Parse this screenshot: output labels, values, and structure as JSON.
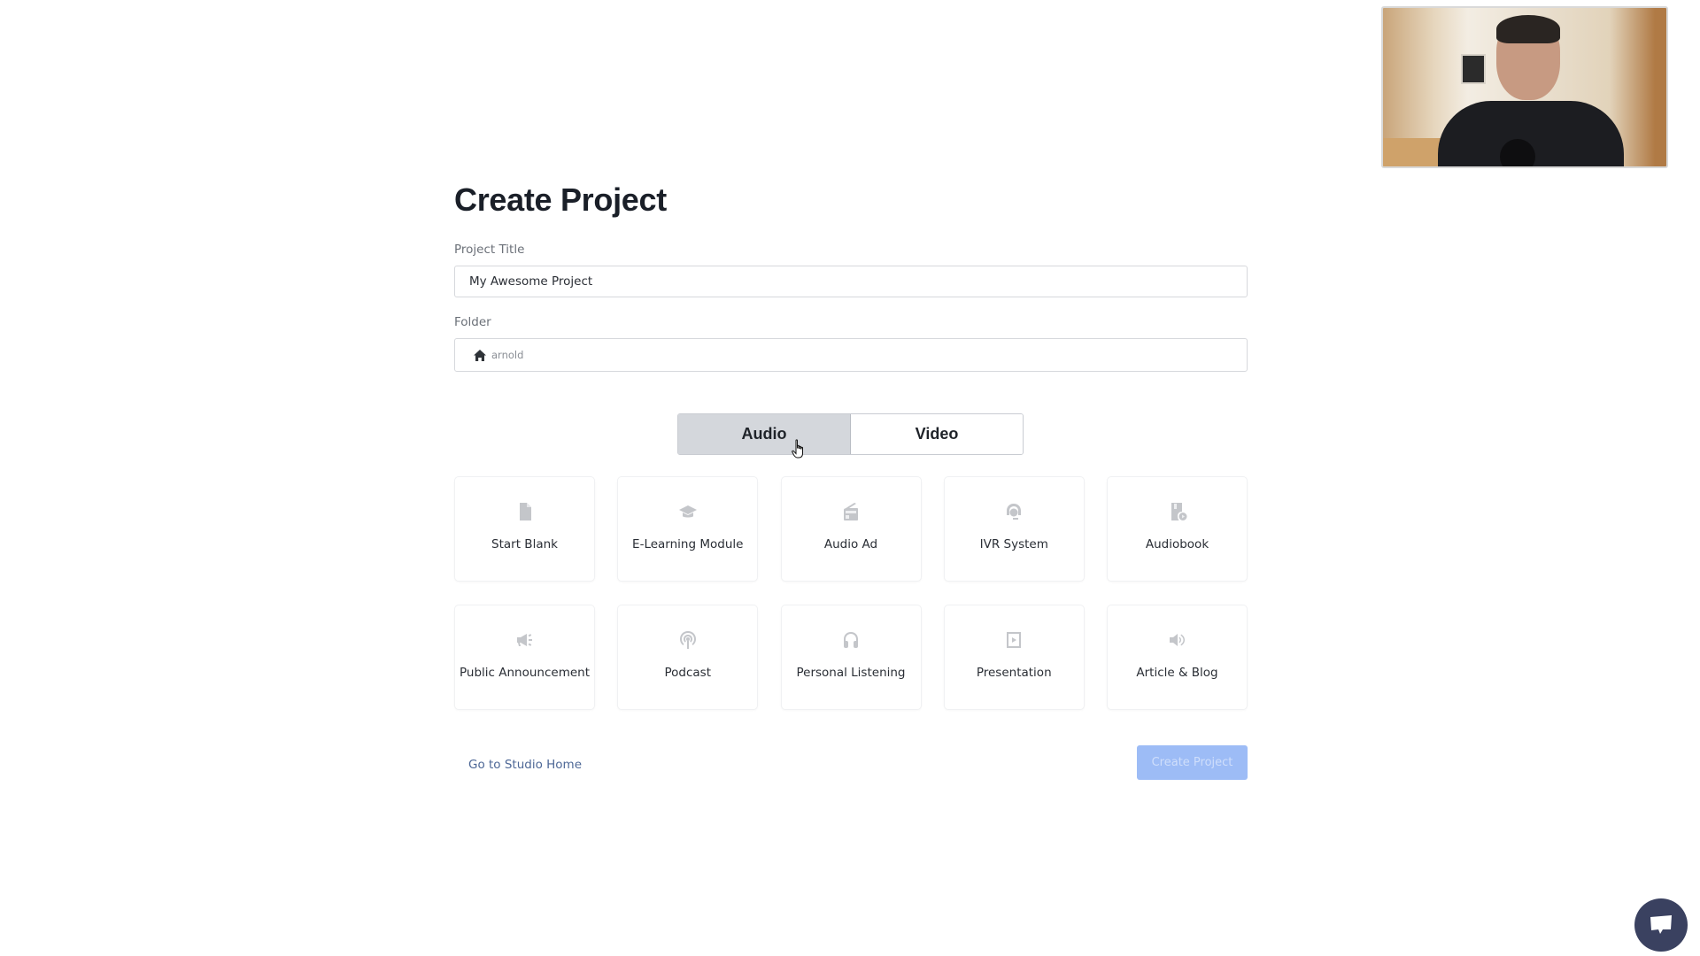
{
  "page": {
    "title": "Create Project"
  },
  "form": {
    "project_title_label": "Project Title",
    "project_title_value": "My Awesome Project",
    "folder_label": "Folder",
    "folder_icon": "home-icon",
    "folder_value": "arnold"
  },
  "type_toggle": {
    "options": [
      {
        "label": "Audio",
        "active": true
      },
      {
        "label": "Video",
        "active": false
      }
    ]
  },
  "templates": [
    {
      "label": "Start Blank",
      "icon": "file-icon"
    },
    {
      "label": "E-Learning Module",
      "icon": "graduation-cap-icon"
    },
    {
      "label": "Audio Ad",
      "icon": "radio-icon"
    },
    {
      "label": "IVR System",
      "icon": "headset-agent-icon"
    },
    {
      "label": "Audiobook",
      "icon": "audiobook-icon"
    },
    {
      "label": "Public Announcement",
      "icon": "megaphone-icon"
    },
    {
      "label": "Podcast",
      "icon": "podcast-icon"
    },
    {
      "label": "Personal Listening",
      "icon": "headphones-icon"
    },
    {
      "label": "Presentation",
      "icon": "play-square-icon"
    },
    {
      "label": "Article & Blog",
      "icon": "volume-icon"
    }
  ],
  "footer": {
    "studio_home_link": "Go to Studio Home",
    "create_button": "Create Project",
    "create_button_disabled": true
  },
  "colors": {
    "primary_disabled": "#9dbcf6",
    "link": "#4d6796",
    "toggle_active_bg": "#d4d7dc",
    "chat_bubble": "#3a4160",
    "icon_gray": "#c4c6ca"
  },
  "overlays": {
    "webcam": "webcam-feed",
    "chat_widget": "chat-icon"
  }
}
